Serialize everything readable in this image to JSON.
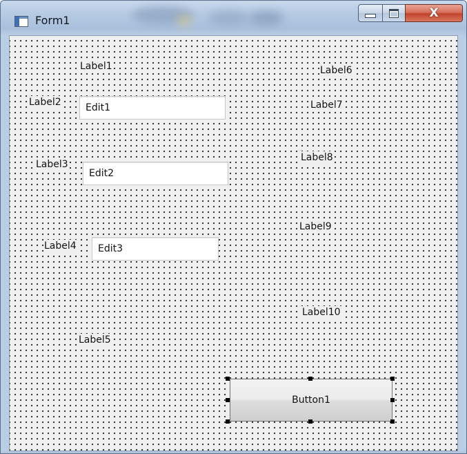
{
  "window": {
    "title": "Form1",
    "close_glyph": "X",
    "icons": {
      "app": "form-window-icon",
      "minimize": "minimize-icon",
      "maximize": "maximize-icon",
      "close": "close-icon"
    },
    "colors": {
      "frame": "#b7cbe3",
      "close_button": "#c2432b",
      "client_background": "#f0f0f0",
      "design_grid_dots": "#1f1f1f"
    }
  },
  "form": {
    "labels": {
      "label1": "Label1",
      "label2": "Label2",
      "label3": "Label3",
      "label4": "Label4",
      "label5": "Label5",
      "label6": "Label6",
      "label7": "Label7",
      "label8": "Label8",
      "label9": "Label9",
      "label10": "Label10"
    },
    "edits": {
      "edit1": "Edit1",
      "edit2": "Edit2",
      "edit3": "Edit3"
    },
    "button1": {
      "label": "Button1",
      "selected": true
    }
  }
}
